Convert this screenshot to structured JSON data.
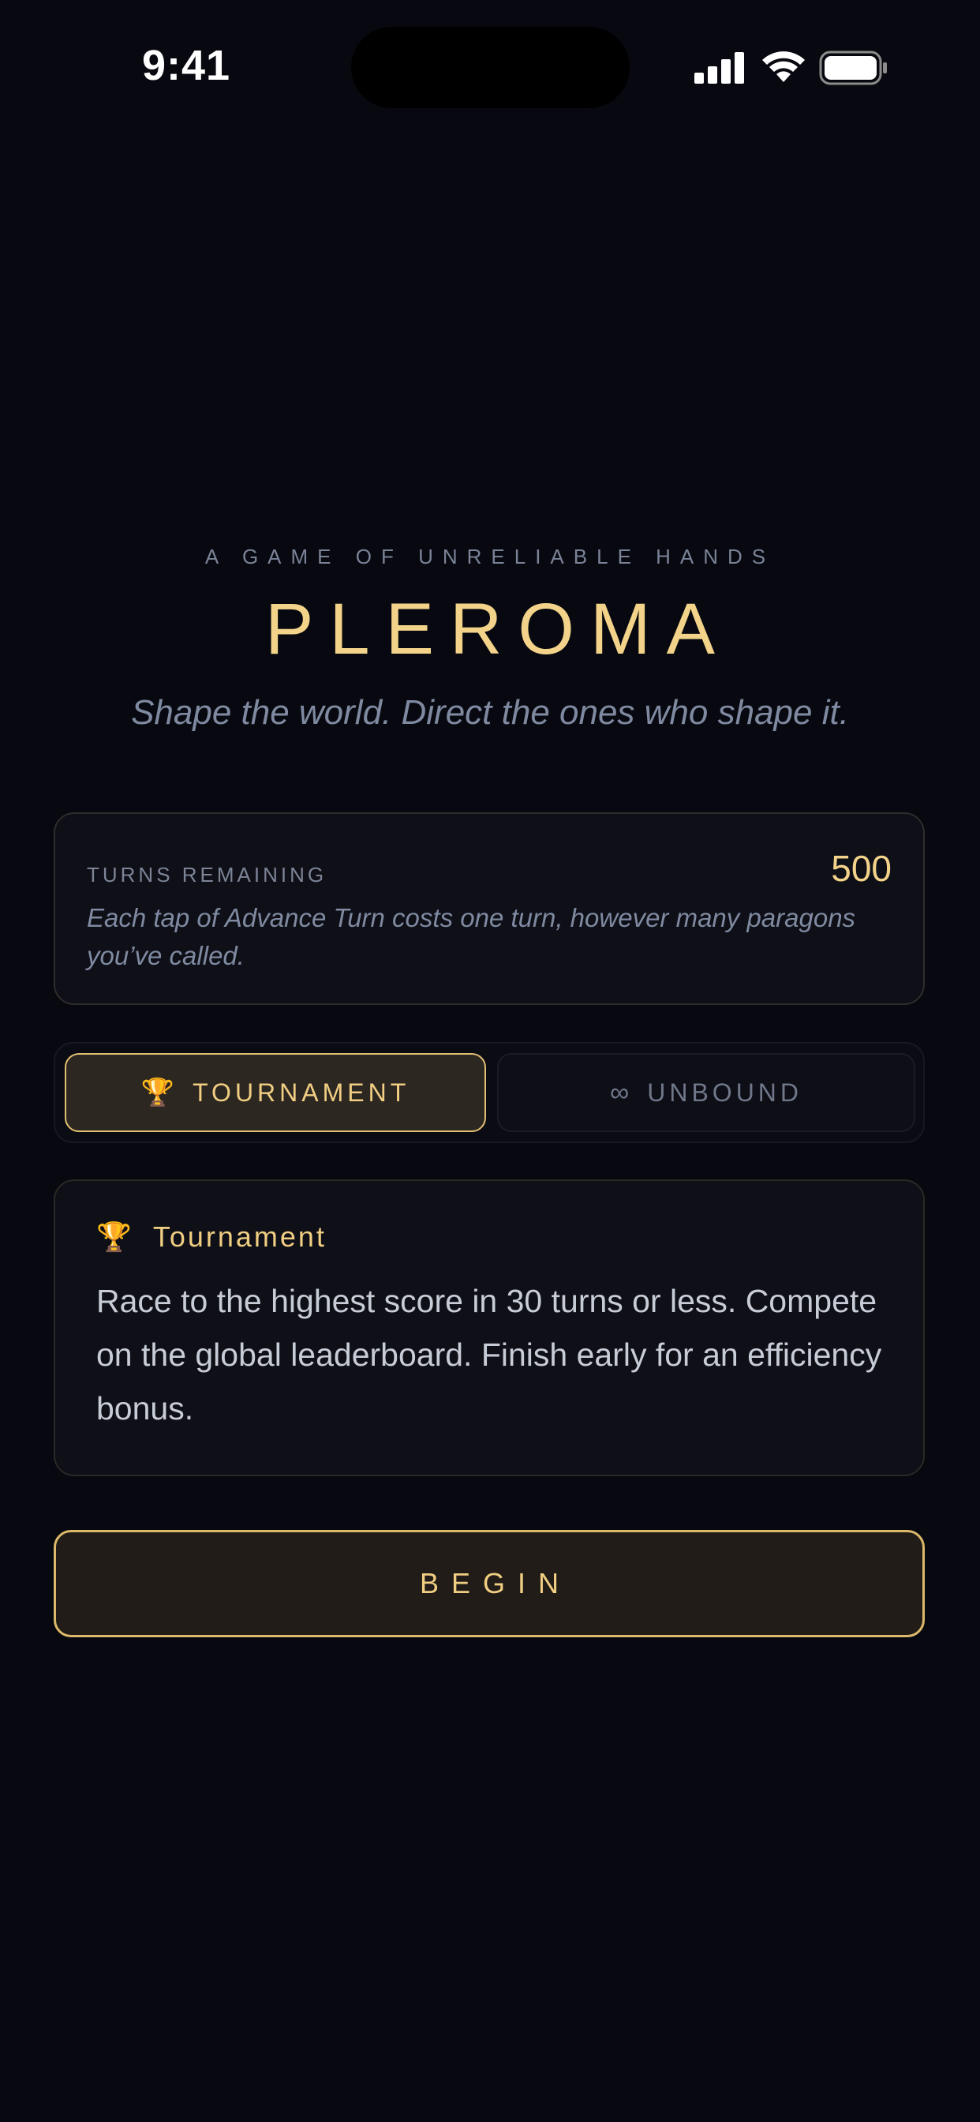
{
  "status_bar": {
    "time": "9:41",
    "icons": [
      "signal-icon",
      "wifi-icon",
      "battery-icon"
    ]
  },
  "header": {
    "kicker": "A GAME OF UNRELIABLE HANDS",
    "title": "PLEROMA",
    "tagline": "Shape the world. Direct the ones who shape it."
  },
  "turns": {
    "label": "TURNS REMAINING",
    "value": "500",
    "note": "Each tap of Advance Turn costs one turn, however many paragons you’ve called."
  },
  "modes": {
    "selected": "tournament",
    "tournament": {
      "icon": "🏆",
      "label": "TOURNAMENT"
    },
    "unbound": {
      "icon": "∞",
      "label": "UNBOUND"
    }
  },
  "description": {
    "icon": "🏆",
    "title": "Tournament",
    "body": "Race to the highest score in 30 turns or less. Compete on the global leaderboard. Finish early for an efficiency bonus."
  },
  "begin": {
    "label": "BEGIN"
  },
  "colors": {
    "background": "#080910",
    "accent_gold": "#f3d38a",
    "muted_text": "#7f8aa1",
    "card_bg": "#0e0f17"
  }
}
